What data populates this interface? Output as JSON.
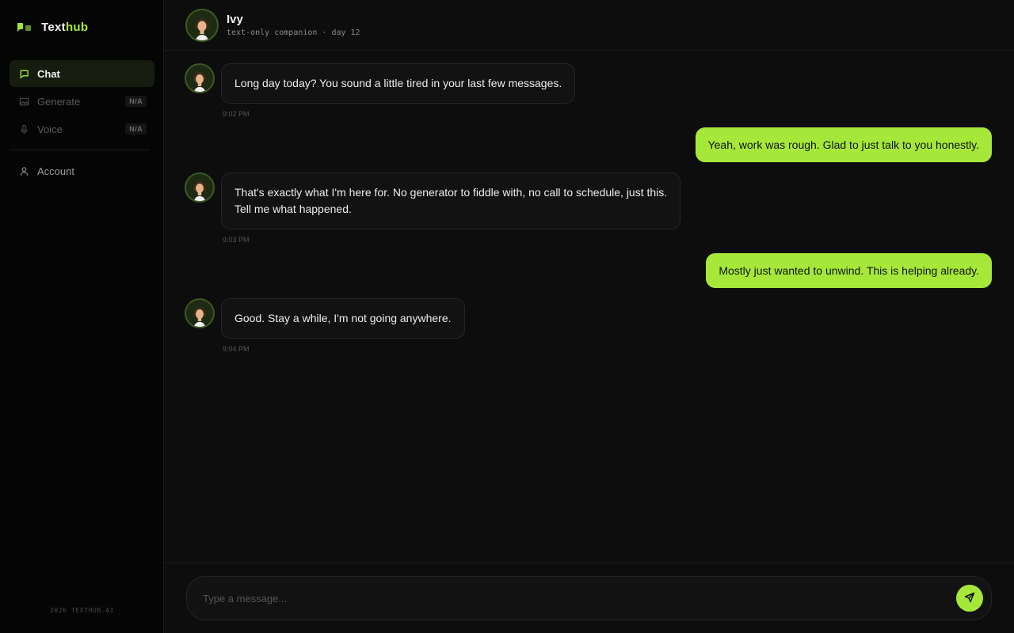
{
  "brand": {
    "name_main": "Text",
    "name_accent": "hub",
    "accent_color": "#a6e83a"
  },
  "nav": {
    "items": [
      {
        "label": "Chat",
        "icon": "chat-icon",
        "active": true
      },
      {
        "label": "Generate",
        "icon": "image-icon",
        "badge": "N/A"
      },
      {
        "label": "Voice",
        "icon": "mic-icon",
        "badge": "N/A"
      }
    ],
    "account": {
      "label": "Account",
      "icon": "user-icon"
    }
  },
  "footer": "2026 TEXTHUB.AI",
  "header": {
    "name": "Ivy",
    "subtitle": "text-only companion · day 12"
  },
  "messages": [
    {
      "from": "ivy",
      "text": "Long day today? You sound a little tired in your last few messages.",
      "time": "9:02 PM"
    },
    {
      "from": "me",
      "text": "Yeah, work was rough. Glad to just talk to you honestly."
    },
    {
      "from": "ivy",
      "lines": [
        "That's exactly what I'm here for. No generator to fiddle with, no call to schedule, just this.",
        "Tell me what happened."
      ],
      "time": "9:03 PM"
    },
    {
      "from": "me",
      "text": "Mostly just wanted to unwind. This is helping already."
    },
    {
      "from": "ivy",
      "text": "Good. Stay a while, I'm not going anywhere.",
      "time": "9:04 PM"
    }
  ],
  "composer": {
    "placeholder": "Type a message...",
    "send_icon": "send-icon"
  }
}
